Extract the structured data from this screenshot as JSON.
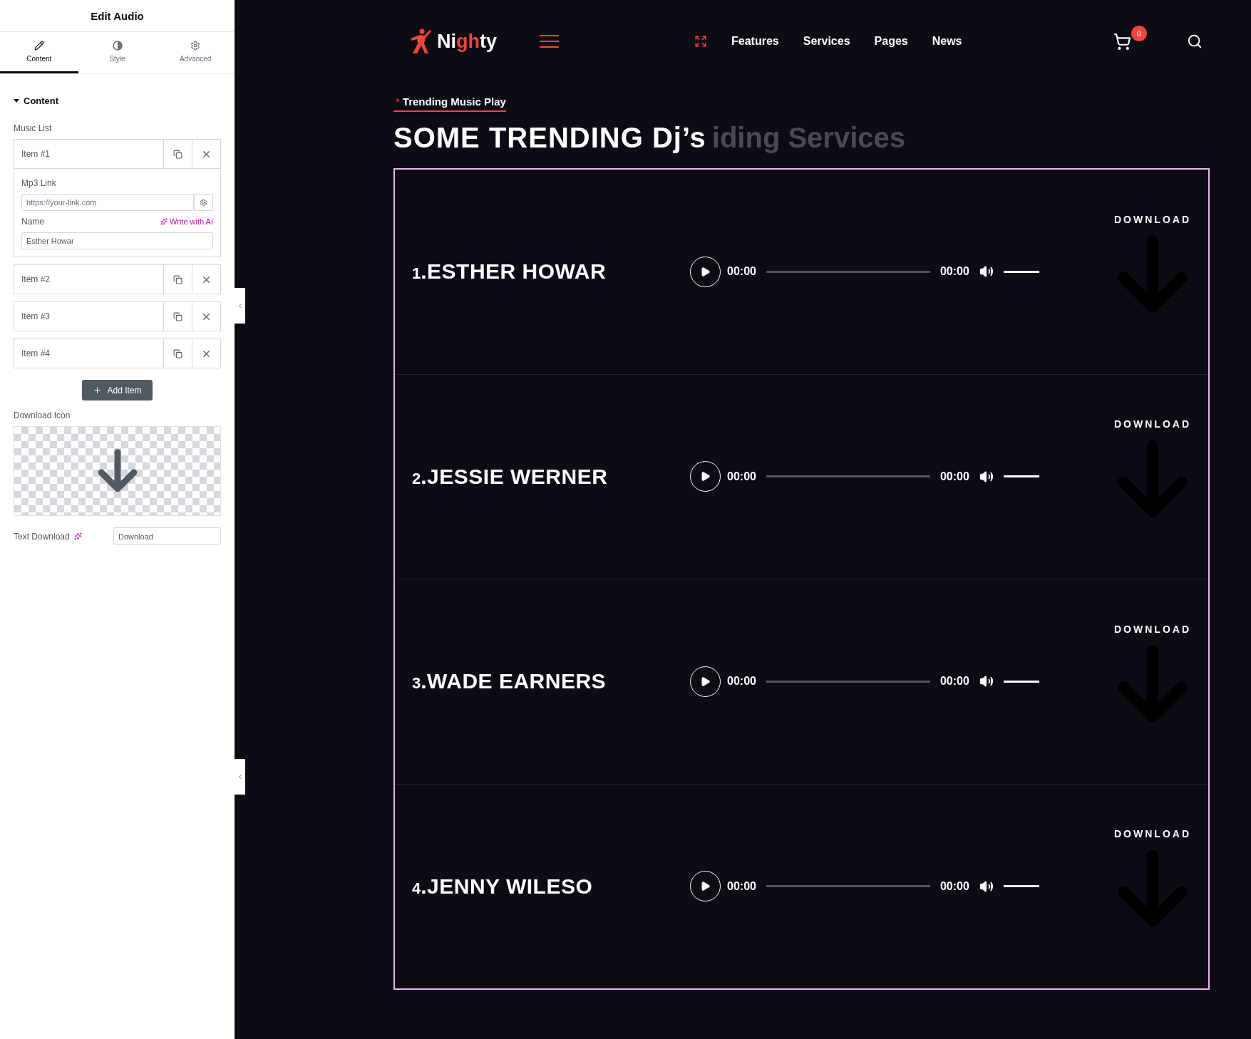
{
  "editor": {
    "title": "Edit Audio",
    "tabs": [
      {
        "label": "Content",
        "kind": "pencil",
        "selected": true
      },
      {
        "label": "Style",
        "kind": "contrast",
        "selected": false
      },
      {
        "label": "Advanced",
        "kind": "gear",
        "selected": false
      }
    ],
    "section": {
      "title": "Content",
      "expanded": true
    },
    "music_list": {
      "label": "Music List",
      "items": [
        {
          "title": "Item #1",
          "expanded": true,
          "mp3_label": "Mp3 Link",
          "mp3_placeholder": "https://your-link.com",
          "name_label": "Name",
          "ai_label": "Write with AI",
          "name_value": "Esther Howar"
        },
        {
          "title": "Item #2",
          "expanded": false
        },
        {
          "title": "Item #3",
          "expanded": false
        },
        {
          "title": "Item #4",
          "expanded": false
        }
      ]
    },
    "add_button": "Add Item",
    "download_icon_label": "Download Icon",
    "text_download": {
      "label": "Text Download",
      "value": "Download"
    }
  },
  "site": {
    "logo": {
      "before": "Ni",
      "accent": "gh",
      "after": "ty"
    },
    "nav": [
      "Features",
      "Services",
      "Pages",
      "News"
    ],
    "cart_count": "0",
    "subtitle": {
      "marker": "*",
      "text": "Trending Music Play"
    },
    "heading": "SOME TRENDING Dj’s",
    "ghost_heading": "iding Services",
    "tracks": [
      {
        "number": "1",
        "title": ".ESTHER HOWAR",
        "current": "00:00",
        "duration": "00:00",
        "progress": {
          "level": 0
        },
        "volume": {
          "level": 1
        },
        "download": "DOWNLOAD"
      },
      {
        "number": "2",
        "title": ".JESSIE WERNER",
        "current": "00:00",
        "duration": "00:00",
        "progress": {
          "level": 0
        },
        "volume": {
          "level": 1
        },
        "download": "DOWNLOAD"
      },
      {
        "number": "3",
        "title": ".WADE EARNERS",
        "current": "00:00",
        "duration": "00:00",
        "progress": {
          "level": 0
        },
        "volume": {
          "level": 1
        },
        "download": "DOWNLOAD"
      },
      {
        "number": "4",
        "title": ".JENNY WILESO",
        "current": "00:00",
        "duration": "00:00",
        "progress": {
          "level": 0
        },
        "volume": {
          "level": 1
        },
        "download": "DOWNLOAD"
      }
    ]
  }
}
